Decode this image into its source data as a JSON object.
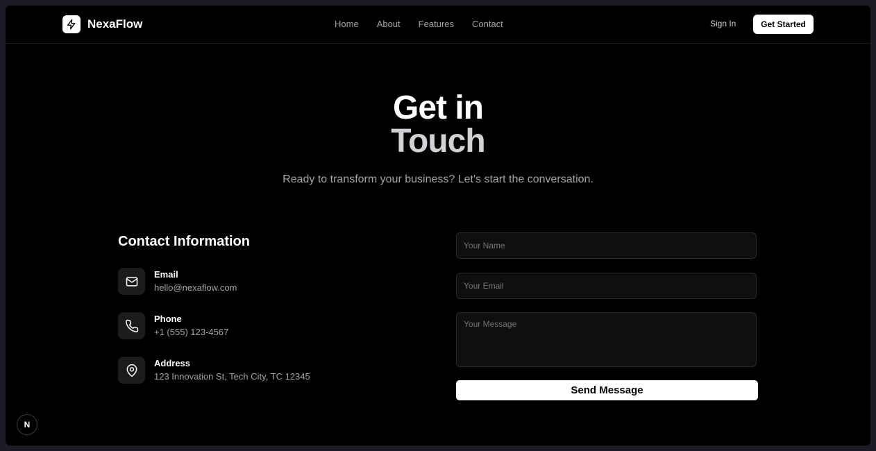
{
  "brand": {
    "name": "NexaFlow",
    "logo_icon": "lightning-bolt-icon"
  },
  "nav": {
    "links": [
      "Home",
      "About",
      "Features",
      "Contact"
    ],
    "sign_in": "Sign In",
    "get_started": "Get Started"
  },
  "hero": {
    "title_line1": "Get in",
    "title_line2": "Touch",
    "subtitle": "Ready to transform your business? Let's start the conversation."
  },
  "contact_info": {
    "heading": "Contact Information",
    "items": [
      {
        "icon": "mail-icon",
        "label": "Email",
        "value": "hello@nexaflow.com"
      },
      {
        "icon": "phone-icon",
        "label": "Phone",
        "value": "+1 (555) 123-4567"
      },
      {
        "icon": "map-pin-icon",
        "label": "Address",
        "value": "123 Innovation St, Tech City, TC 12345"
      }
    ]
  },
  "form": {
    "name_placeholder": "Your Name",
    "email_placeholder": "Your Email",
    "message_placeholder": "Your Message",
    "submit_label": "Send Message"
  },
  "dev_badge": {
    "letter": "N"
  },
  "colors": {
    "background": "#000000",
    "frame": "#1c1b26",
    "accent": "#ffffff",
    "muted_text": "#a3a3a3",
    "icon_tile": "#1c1c1c"
  }
}
